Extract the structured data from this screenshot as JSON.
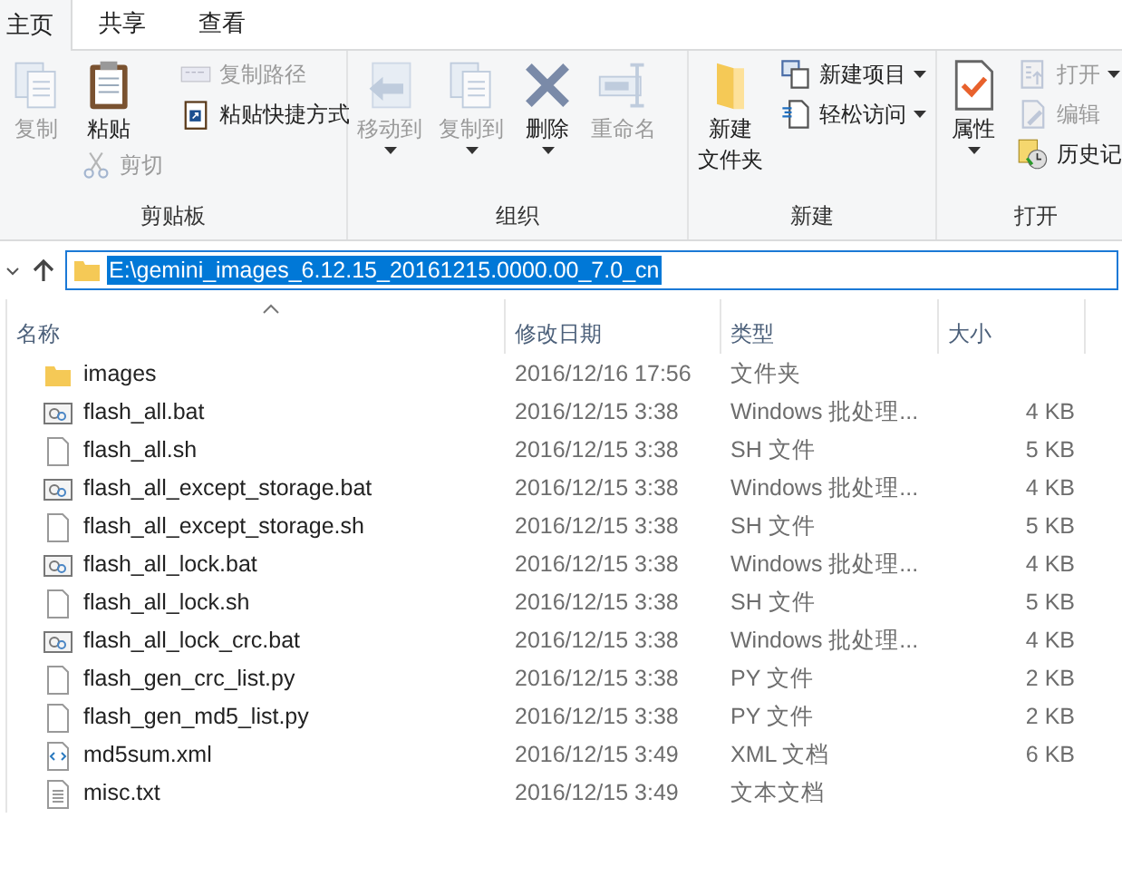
{
  "tabs": [
    {
      "label": "主页",
      "selected": true
    },
    {
      "label": "共享",
      "selected": false
    },
    {
      "label": "查看",
      "selected": false
    }
  ],
  "ribbon": [
    {
      "label": "剪贴板",
      "columns": [
        {
          "kind": "large",
          "lines": [
            "复制"
          ],
          "disabled": true,
          "dropdown": false
        },
        {
          "kind": "pasteCut",
          "items": [
            {
              "label": "粘贴",
              "disabled": false
            },
            {
              "label": "剪切",
              "disabled": true
            }
          ]
        },
        {
          "kind": "stack",
          "items": [
            {
              "label": "复制路径",
              "disabled": true,
              "dropdown": false
            },
            {
              "label": "粘贴快捷方式",
              "disabled": false,
              "dropdown": false
            }
          ]
        }
      ]
    },
    {
      "label": "组织",
      "columns": [
        {
          "kind": "large",
          "lines": [
            "移动到"
          ],
          "disabled": true,
          "dropdown": true
        },
        {
          "kind": "large",
          "lines": [
            "复制到"
          ],
          "disabled": true,
          "dropdown": true
        },
        {
          "kind": "large",
          "lines": [
            "删除"
          ],
          "disabled": false,
          "dropdown": true
        },
        {
          "kind": "large",
          "lines": [
            "重命名"
          ],
          "disabled": true,
          "dropdown": false
        }
      ]
    },
    {
      "label": "新建",
      "columns": [
        {
          "kind": "large",
          "lines": [
            "新建",
            "文件夹"
          ],
          "disabled": false,
          "dropdown": false
        },
        {
          "kind": "stack",
          "items": [
            {
              "label": "新建项目",
              "disabled": false,
              "dropdown": true
            },
            {
              "label": "轻松访问",
              "disabled": false,
              "dropdown": true
            }
          ]
        }
      ]
    },
    {
      "label": "打开",
      "columns": [
        {
          "kind": "large",
          "lines": [
            "属性"
          ],
          "disabled": false,
          "dropdown": true
        },
        {
          "kind": "stack",
          "items": [
            {
              "label": "打开",
              "disabled": true,
              "dropdown": true
            },
            {
              "label": "编辑",
              "disabled": true,
              "dropdown": false
            },
            {
              "label": "历史记",
              "disabled": false
            }
          ]
        }
      ]
    }
  ],
  "address": {
    "value": "E:\\gemini_images_6.12.15_20161215.0000.00_7.0_cn",
    "selected": true
  },
  "columns": [
    "名称",
    "修改日期",
    "类型",
    "大小"
  ],
  "files": [
    {
      "kind": "folder",
      "name": "images",
      "date": "2016/12/16 17:56",
      "type": "文件夹"
    },
    {
      "kind": "bat",
      "name": "flash_all.bat",
      "date": "2016/12/15 3:38",
      "type": "Windows 批处理...",
      "size": "4 KB"
    },
    {
      "kind": "file",
      "name": "flash_all.sh",
      "date": "2016/12/15 3:38",
      "type": "SH 文件",
      "size": "5 KB"
    },
    {
      "kind": "bat",
      "name": "flash_all_except_storage.bat",
      "date": "2016/12/15 3:38",
      "type": "Windows 批处理...",
      "size": "4 KB"
    },
    {
      "kind": "file",
      "name": "flash_all_except_storage.sh",
      "date": "2016/12/15 3:38",
      "type": "SH 文件",
      "size": "5 KB"
    },
    {
      "kind": "bat",
      "name": "flash_all_lock.bat",
      "date": "2016/12/15 3:38",
      "type": "Windows 批处理...",
      "size": "4 KB"
    },
    {
      "kind": "file",
      "name": "flash_all_lock.sh",
      "date": "2016/12/15 3:38",
      "type": "SH 文件",
      "size": "5 KB"
    },
    {
      "kind": "bat",
      "name": "flash_all_lock_crc.bat",
      "date": "2016/12/15 3:38",
      "type": "Windows 批处理...",
      "size": "4 KB"
    },
    {
      "kind": "file",
      "name": "flash_gen_crc_list.py",
      "date": "2016/12/15 3:38",
      "type": "PY 文件",
      "size": "2 KB"
    },
    {
      "kind": "file",
      "name": "flash_gen_md5_list.py",
      "date": "2016/12/15 3:38",
      "type": "PY 文件",
      "size": "2 KB"
    },
    {
      "kind": "xml",
      "name": "md5sum.xml",
      "date": "2016/12/15 3:49",
      "type": "XML 文档",
      "size": "6 KB"
    },
    {
      "kind": "txt",
      "name": "misc.txt",
      "date": "2016/12/15 3:49",
      "type": "文本文档"
    }
  ]
}
